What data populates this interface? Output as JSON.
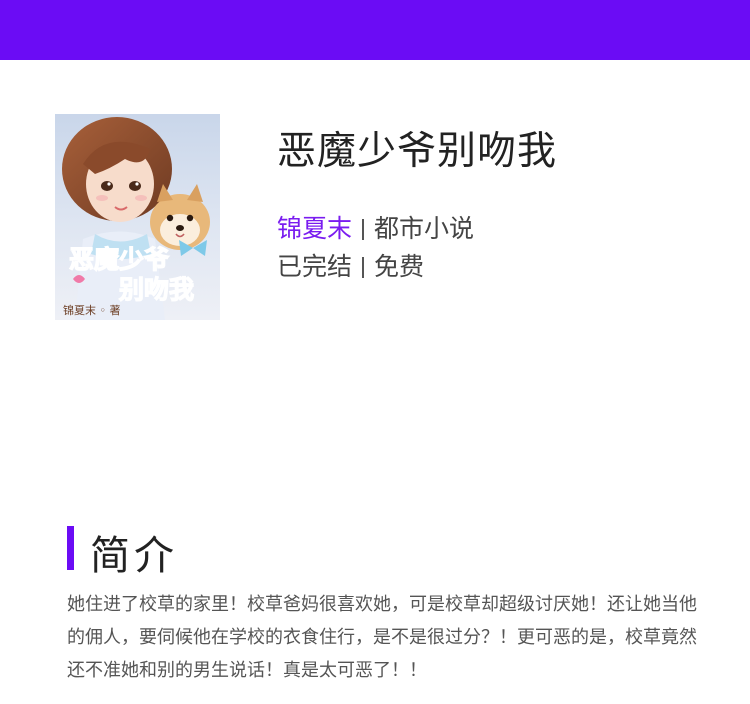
{
  "header": {
    "bar_color": "#6b0cf5"
  },
  "book": {
    "title": "恶魔少爷别吻我",
    "author": "锦夏末",
    "category": "都市小说",
    "status": "已完结",
    "price": "免费",
    "cover": {
      "title_art": "恶魔少爷别吻我",
      "author_art": "锦夏末",
      "author_suffix": "著"
    }
  },
  "intro": {
    "heading": "简介",
    "text": "她住进了校草的家里！校草爸妈很喜欢她，可是校草却超级讨厌她！还让她当他的佣人，要伺候他在学校的衣食住行，是不是很过分？！更可恶的是，校草竟然还不准她和别的男生说话！真是太可恶了！！"
  },
  "colors": {
    "accent": "#6b0cf5",
    "author_link": "#7a1cf0",
    "title_text": "#222222",
    "body_text": "#555555"
  }
}
